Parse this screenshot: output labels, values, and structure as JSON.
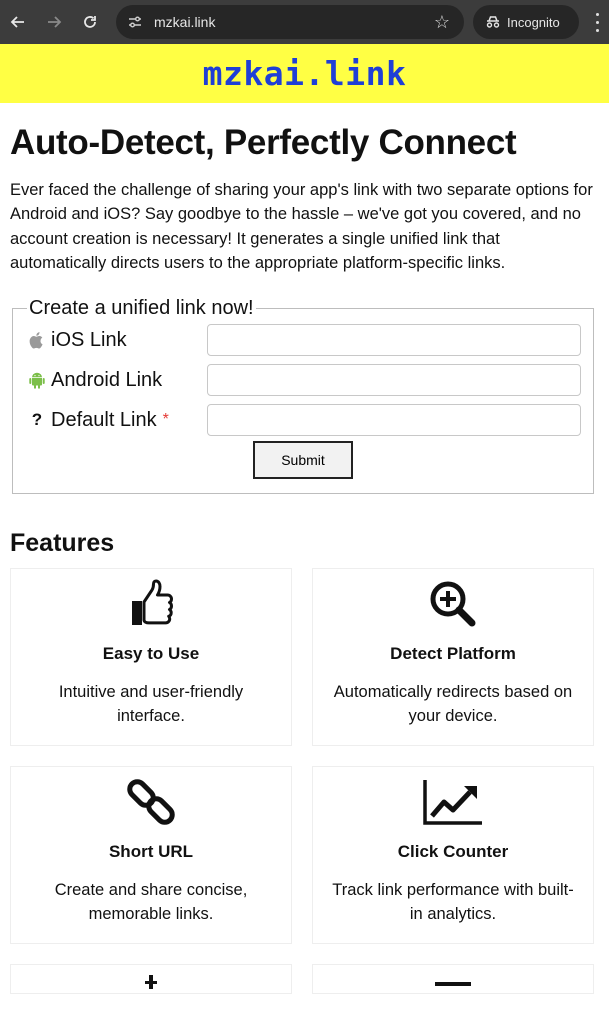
{
  "browser": {
    "url": "mzkai.link",
    "incognito_label": "Incognito"
  },
  "site": {
    "brand": "mzkai.link"
  },
  "hero": {
    "title": "Auto-Detect, Perfectly Connect",
    "description": "Ever faced the challenge of sharing your app's link with two separate options for Android and iOS? Say goodbye to the hassle – we've got you covered, and no account creation is necessary! It generates a single unified link that automatically directs users to the appropriate platform-specific links."
  },
  "form": {
    "legend": "Create a unified link now!",
    "fields": [
      {
        "label": "iOS Link",
        "value": "",
        "icon": "apple-icon"
      },
      {
        "label": "Android Link",
        "value": "",
        "icon": "android-icon"
      },
      {
        "label": "Default Link",
        "value": "",
        "icon": "question-icon",
        "required_mark": "*"
      }
    ],
    "submit_label": "Submit"
  },
  "features": {
    "heading": "Features",
    "items": [
      {
        "title": "Easy to Use",
        "description": "Intuitive and user-friendly interface.",
        "icon": "thumbs-up-icon"
      },
      {
        "title": "Detect Platform",
        "description": "Automatically redirects based on your device.",
        "icon": "magnify-plus-icon"
      },
      {
        "title": "Short URL",
        "description": "Create and share concise, memorable links.",
        "icon": "link-icon"
      },
      {
        "title": "Click Counter",
        "description": "Track link performance with built-in analytics.",
        "icon": "chart-line-icon"
      }
    ]
  }
}
